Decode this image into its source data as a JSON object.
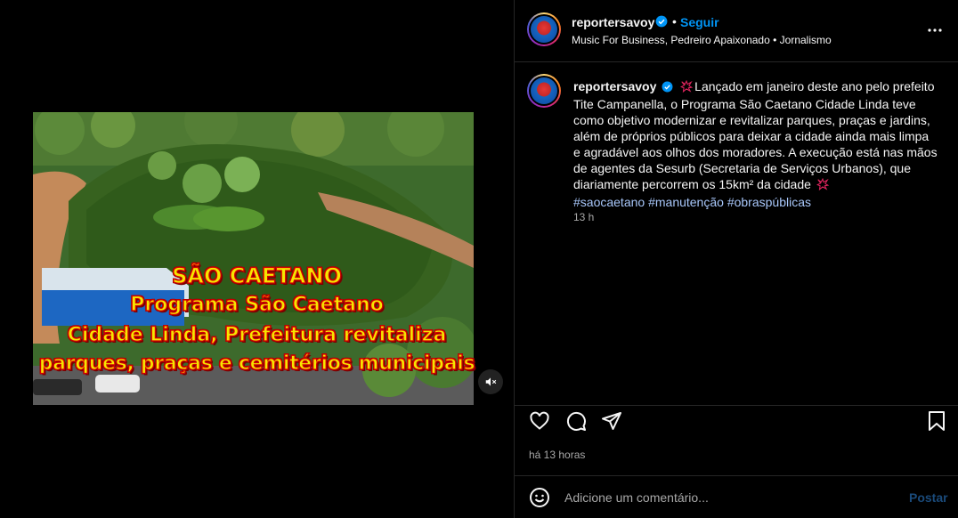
{
  "post": {
    "username": "reportersavoy",
    "follow_label": "Seguir",
    "separator": "•",
    "subtitle": "Music For Business, Pedreiro Apaixonado • Jornalismo",
    "caption_text": "Lançado em janeiro deste ano pelo prefeito Tite Campanella, o Programa São Caetano Cidade Linda teve como objetivo modernizar e revitalizar parques, praças e jardins, além de próprios públicos para deixar a cidade ainda mais limpa e agradável aos olhos dos moradores. A execução está nas mãos de agentes da Sesurb (Secretaria de Serviços Urbanos), que diariamente percorrem os 15km² da cidade",
    "hashtags": [
      "#saocaetano",
      "#manutenção",
      "#obraspúblicas"
    ],
    "caption_time": "13 h",
    "posted_ago": "há 13 horas"
  },
  "media": {
    "overlay": {
      "line1": "SÃO CAETANO",
      "line2": "Programa São Caetano",
      "line3": "Cidade Linda, Prefeitura revitaliza",
      "line4": "parques, praças e cemitérios municipais"
    },
    "mute_icon": "speaker-muted-icon"
  },
  "comment": {
    "placeholder": "Adicione um comentário...",
    "post_label": "Postar"
  },
  "icons": {
    "verified": "verified-badge-icon",
    "more": "more-horizontal-icon",
    "like": "heart-icon",
    "comment": "comment-bubble-icon",
    "share": "paper-plane-icon",
    "save": "bookmark-icon",
    "emoji": "smiley-icon",
    "caption_prefix": "red-sparkle-icon"
  },
  "colors": {
    "accent": "#0095f6",
    "background": "#000000",
    "muted_text": "#a8a8a8",
    "hashtag": "#a8c7fa",
    "overlay_text": "#f5e600",
    "overlay_stroke": "#d40000"
  }
}
